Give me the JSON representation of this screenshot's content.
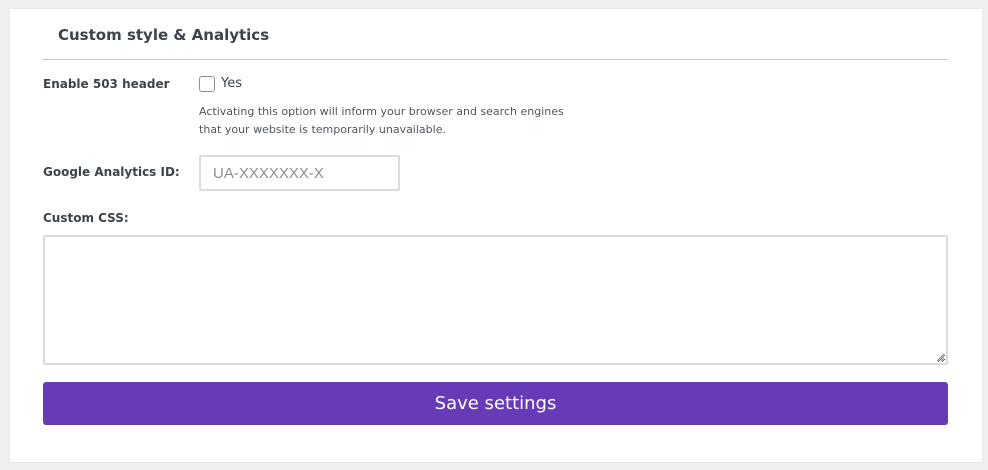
{
  "section": {
    "title": "Custom style & Analytics"
  },
  "enable_503": {
    "label": "Enable 503 header",
    "checkbox_label": "Yes",
    "checked": false,
    "description_line1": "Activating this option will inform your browser and search engines",
    "description_line2": "that your website is temporarily unavailable."
  },
  "google_analytics": {
    "label": "Google Analytics ID:",
    "value": "",
    "placeholder": "UA-XXXXXXX-X"
  },
  "custom_css": {
    "label": "Custom CSS:",
    "value": ""
  },
  "actions": {
    "save_label": "Save settings"
  },
  "colors": {
    "accent": "#673ab7",
    "text": "#3c434a",
    "border": "#dcdcde",
    "background": "#f0f0f1"
  }
}
